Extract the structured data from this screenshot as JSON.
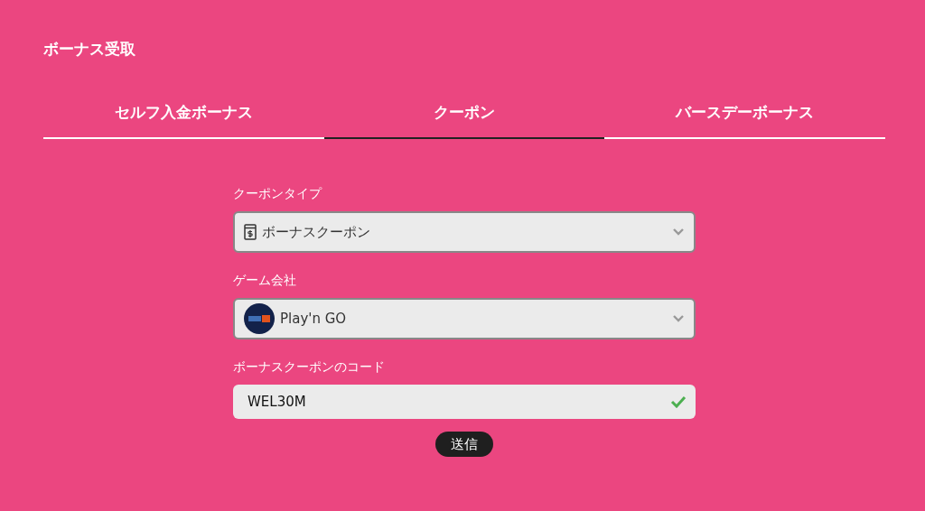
{
  "title": "ボーナス受取",
  "tabs": [
    {
      "label": "セルフ入金ボーナス",
      "selected": false
    },
    {
      "label": "クーポン",
      "selected": true
    },
    {
      "label": "バースデーボーナス",
      "selected": false
    }
  ],
  "fields": [
    {
      "kind": "select",
      "label": "クーポンタイプ",
      "value": "ボーナスクーポン"
    },
    {
      "kind": "select",
      "label": "ゲーム会社",
      "value": "Play'n GO"
    },
    {
      "kind": "input",
      "label": "ボーナスクーポンのコード",
      "value": "WEL30M",
      "valid": true
    }
  ],
  "submit": {
    "label": "送信"
  }
}
